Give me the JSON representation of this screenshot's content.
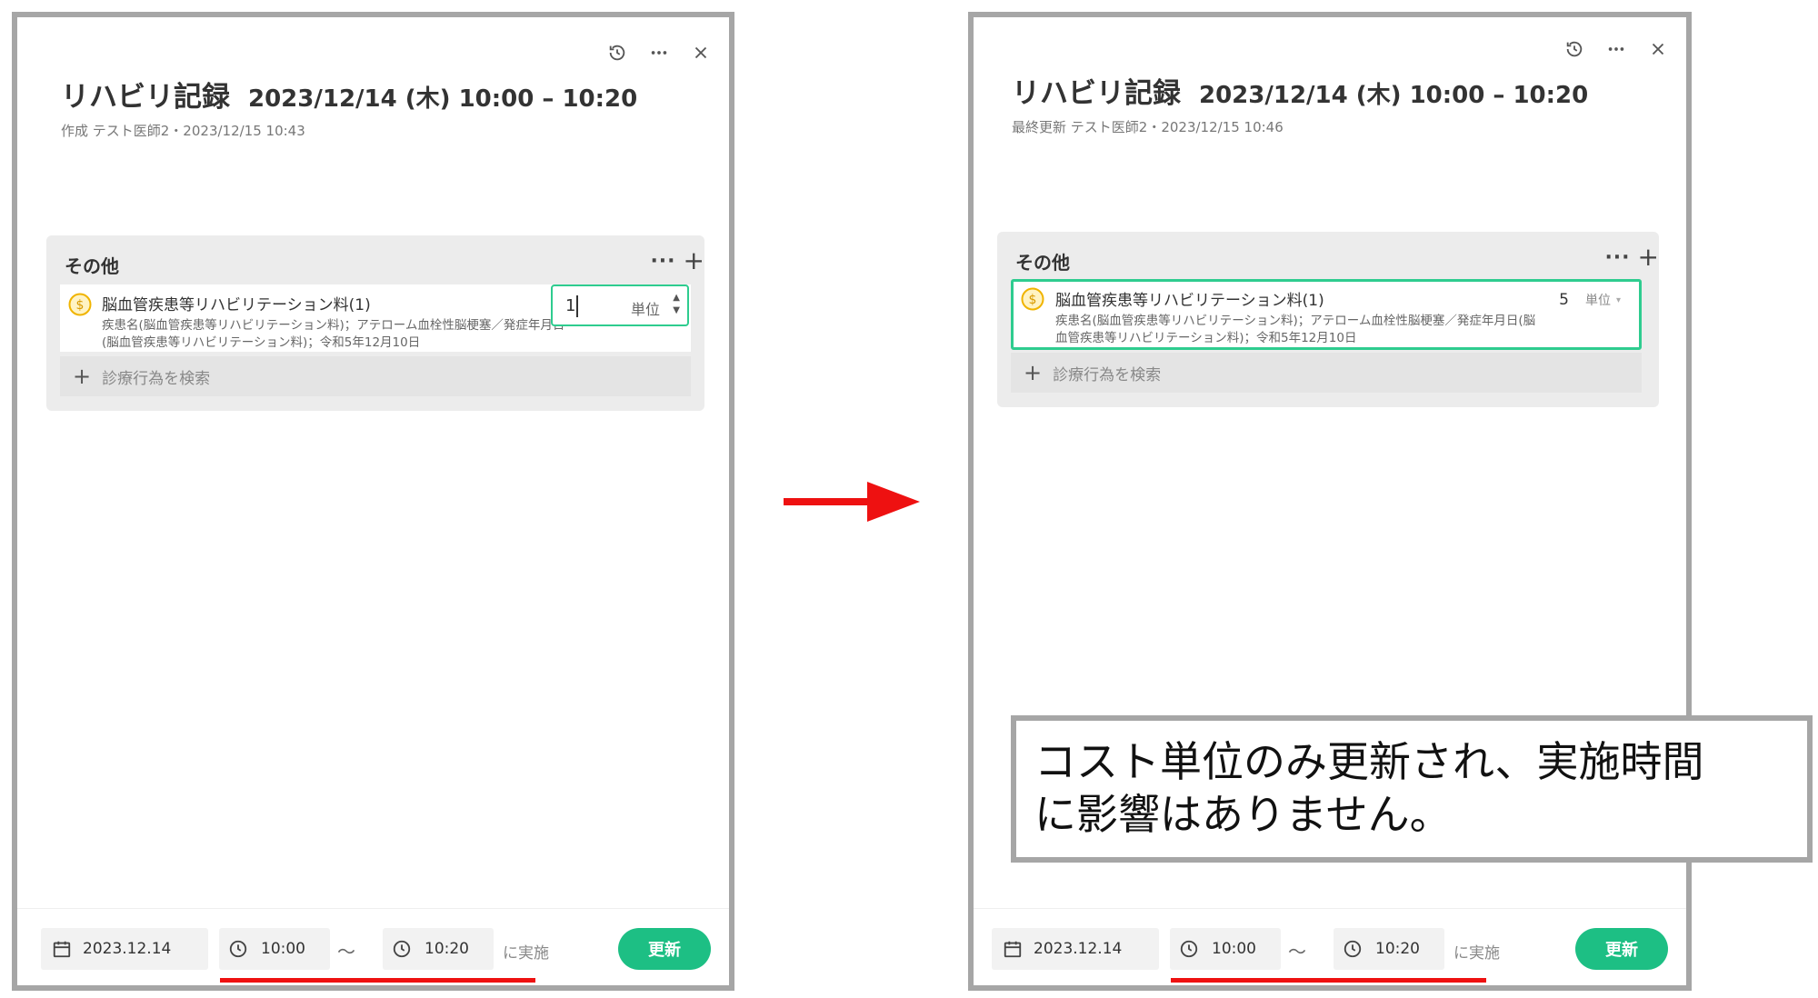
{
  "colors": {
    "accent": "#2ecc8f",
    "button": "#1dbf84",
    "highlight": "#ee1111",
    "coin": "#f0b400"
  },
  "icons": [
    "history-icon",
    "more-icon",
    "close-icon",
    "coin-icon",
    "calendar-icon",
    "clock-icon",
    "plus-icon",
    "arrow-right-icon"
  ],
  "left": {
    "title": "リハビリ記録",
    "datetime": "2023/12/14 (木) 10:00 – 10:20",
    "meta": "作成 テスト医師2・2023/12/15 10:43",
    "section": {
      "title": "その他",
      "more": "···",
      "add": "+",
      "item": {
        "name": "脳血管疾患等リハビリテーション料(1)",
        "detail": "疾患名(脳血管疾患等リハビリテーション料)；アテローム血栓性脳梗塞／発症年月日(脳血管疾患等リハビリテーション料)；令和5年12月10日",
        "units_value": "1",
        "units_label": "単位"
      },
      "search_label": "診療行為を検索"
    },
    "footer": {
      "date": "2023.12.14",
      "start": "10:00",
      "tilde": "～",
      "end": "10:20",
      "suffix": "に実施",
      "update_label": "更新"
    }
  },
  "right": {
    "title": "リハビリ記録",
    "datetime": "2023/12/14 (木) 10:00 – 10:20",
    "meta": "最終更新 テスト医師2・2023/12/15 10:46",
    "section": {
      "title": "その他",
      "more": "···",
      "add": "+",
      "item": {
        "name": "脳血管疾患等リハビリテーション料(1)",
        "detail": "疾患名(脳血管疾患等リハビリテーション料)；アテローム血栓性脳梗塞／発症年月日(脳血管疾患等リハビリテーション料)；令和5年12月10日",
        "units_value": "5",
        "units_label": "単位"
      },
      "search_label": "診療行為を検索"
    },
    "footer": {
      "date": "2023.12.14",
      "start": "10:00",
      "tilde": "～",
      "end": "10:20",
      "suffix": "に実施",
      "update_label": "更新"
    }
  },
  "callout": {
    "line1": "コスト単位のみ更新され、実施時間",
    "line2": "に影響はありません。"
  }
}
